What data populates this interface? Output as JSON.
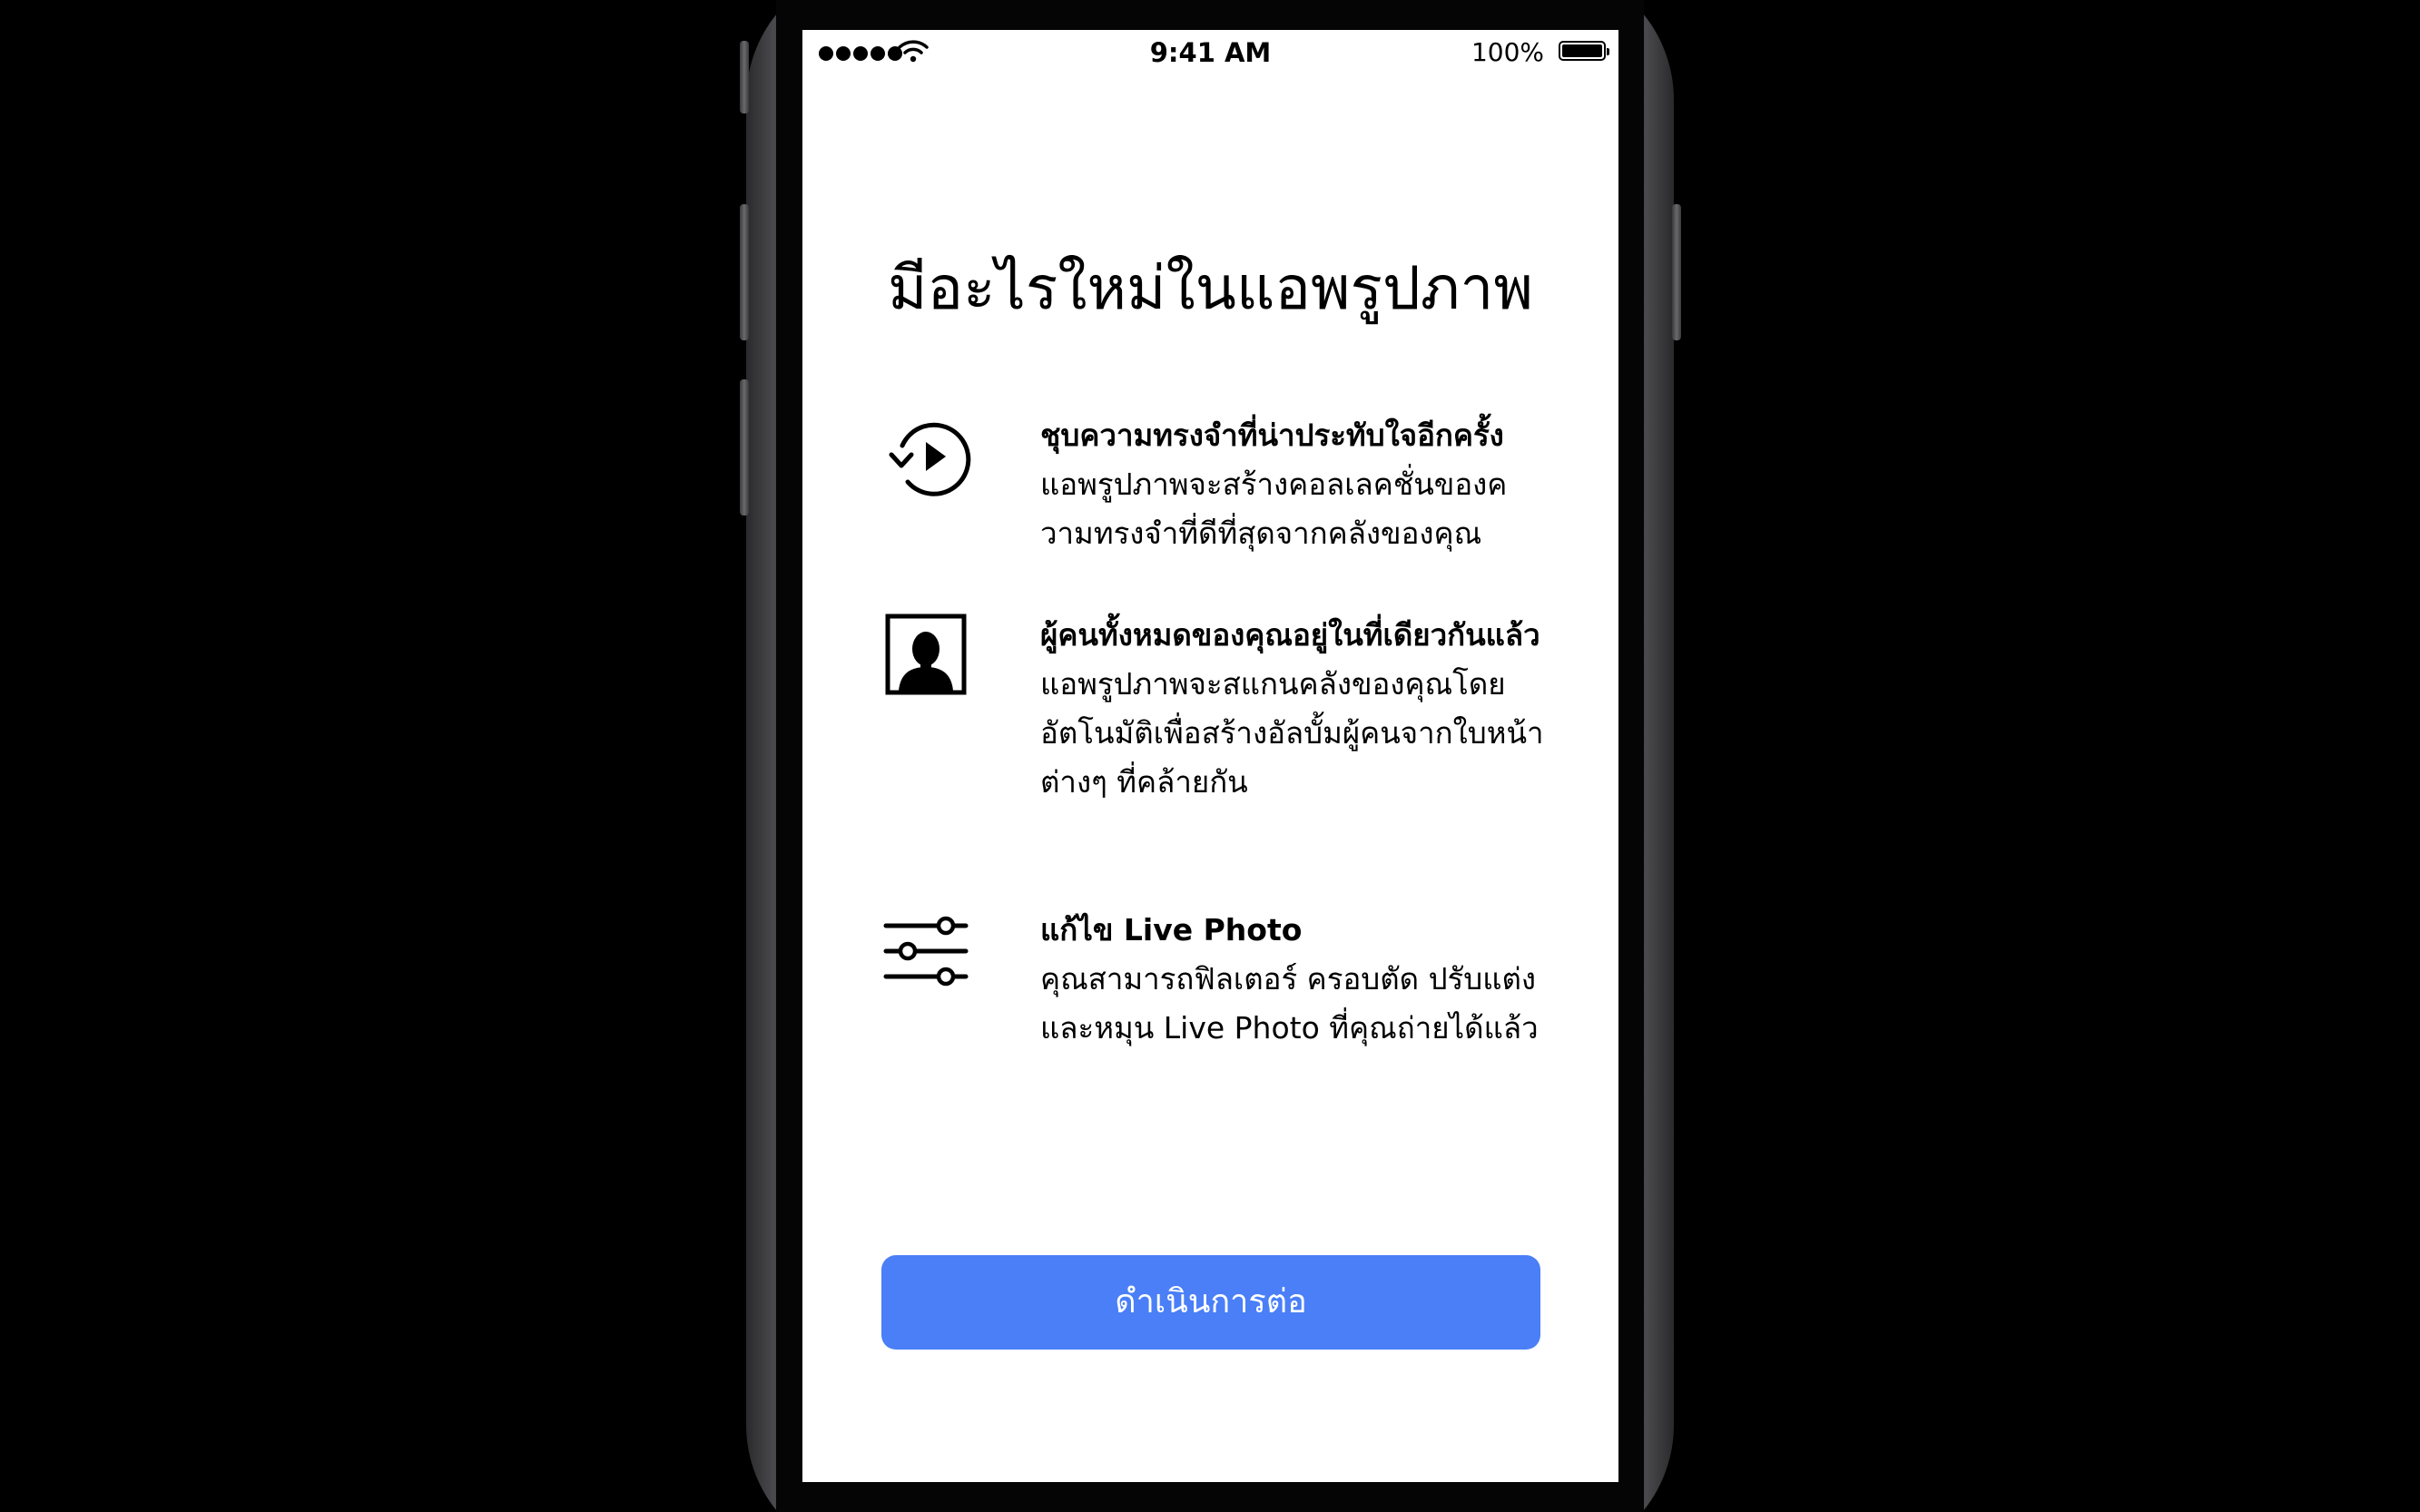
{
  "status_bar": {
    "time": "9:41 AM",
    "battery_percent": "100%",
    "battery_level": 1.0
  },
  "page": {
    "title": "มีอะไรใหม่ในแอพรูปภาพ"
  },
  "features": [
    {
      "icon": "memories-replay-icon",
      "heading": "ชุบความทรงจำที่น่าประทับใจอีกครั้ง",
      "description": "แอพรูปภาพจะสร้างคอลเลคชั่นของความทรงจำที่ดีที่สุดจากคลังของคุณ"
    },
    {
      "icon": "person-portrait-icon",
      "heading": "ผู้คนทั้งหมดของคุณอยู่ในที่เดียวกันแล้ว",
      "description": "แอพรูปภาพจะสแกนคลังของคุณโดยอัตโนมัติเพื่อสร้างอัลบั้มผู้คนจากใบหน้าต่างๆ ที่คล้ายกัน"
    },
    {
      "icon": "sliders-adjust-icon",
      "heading": "แก้ไข Live Photo",
      "description": "คุณสามารถฟิลเตอร์ ครอบตัด ปรับแต่ง และหมุน Live Photo ที่คุณถ่ายได้แล้ว"
    }
  ],
  "actions": {
    "continue_label": "ดำเนินการต่อ"
  },
  "colors": {
    "accent": "#4a7ff7",
    "screen_bg": "#ffffff",
    "background": "#000000"
  }
}
